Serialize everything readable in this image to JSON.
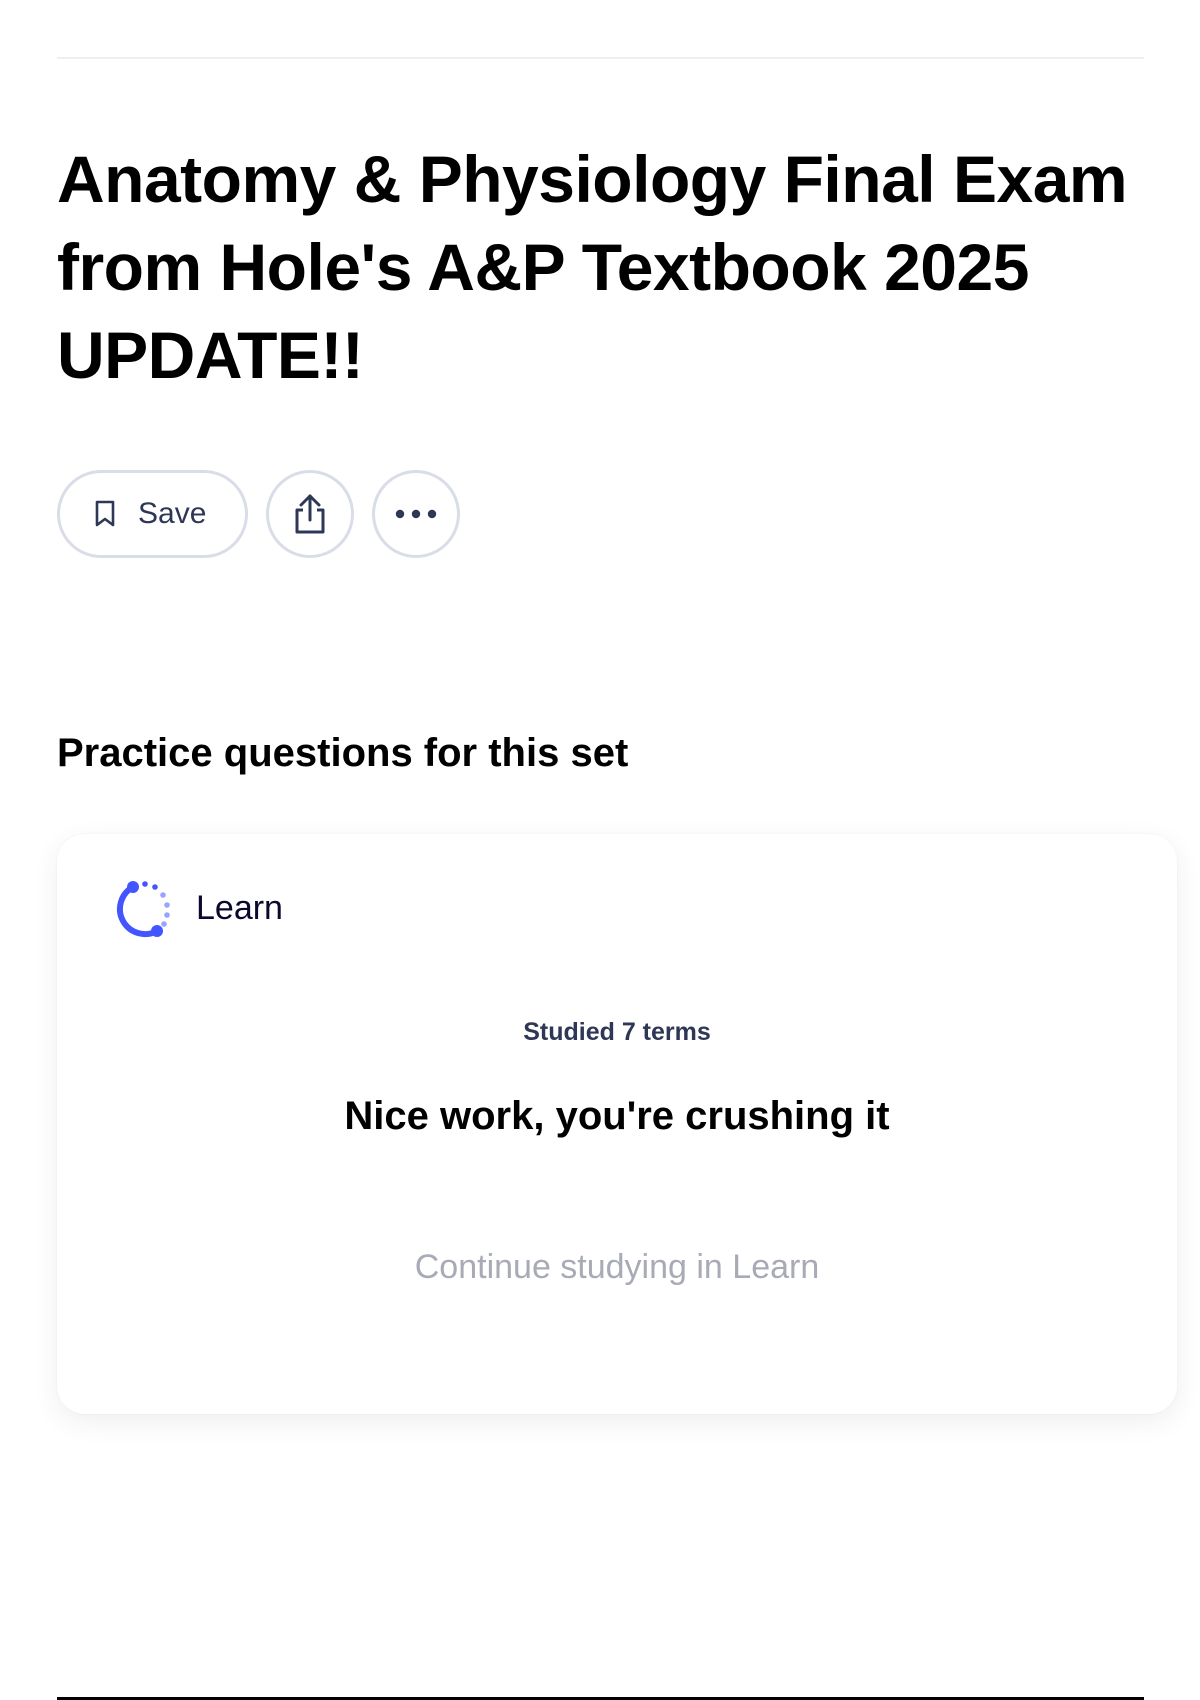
{
  "header": {
    "title": "Anatomy & Physiology Final Exam from Hole's A&P Textbook 2025 UPDATE!!"
  },
  "actions": {
    "save_label": "Save",
    "save_icon": "bookmark-icon",
    "share_icon": "share-icon",
    "more_icon": "more-horizontal-icon"
  },
  "practice": {
    "heading": "Practice questions for this set",
    "card": {
      "mode_label": "Learn",
      "mode_icon": "learn-progress-icon",
      "studied_text": "Studied 7 terms",
      "message": "Nice work, you're crushing it",
      "continue_label": "Continue studying in Learn"
    }
  },
  "colors": {
    "accent": "#4255ff",
    "text_primary": "#000000",
    "text_secondary": "#2e3856",
    "text_muted": "#a8abb5",
    "border": "#d9dde8"
  }
}
